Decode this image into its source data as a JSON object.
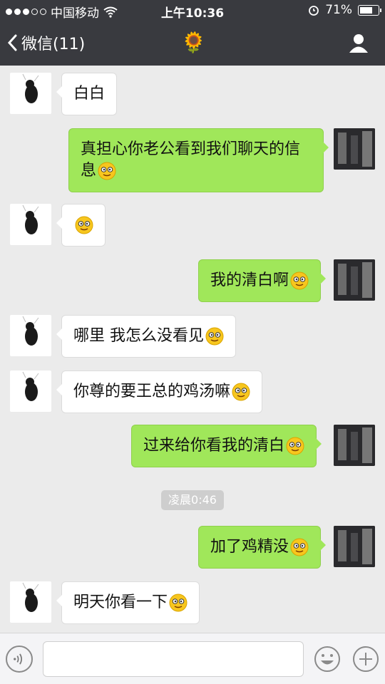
{
  "status": {
    "carrier": "中国移动",
    "time": "上午10:36",
    "battery": "71%",
    "battery_level": 0.71
  },
  "nav": {
    "back_label": "微信(11)",
    "center_icon": "sunflower-icon",
    "profile_icon": "person-icon"
  },
  "messages": [
    {
      "side": "left",
      "text": "白白"
    },
    {
      "side": "right",
      "text": "真担心你老公看到我们聊天的信息",
      "emoji": "grin-emoji"
    },
    {
      "side": "left",
      "text": "",
      "emoji": "grin-emoji"
    },
    {
      "side": "right",
      "text": "我的清白啊",
      "emoji": "grin-emoji"
    },
    {
      "side": "left",
      "text": "哪里 我怎么没看见",
      "emoji": "grin-emoji"
    },
    {
      "side": "left",
      "text": "你尊的要王总的鸡汤嘛",
      "emoji": "grin-emoji"
    },
    {
      "side": "right",
      "text": "过来给你看我的清白",
      "emoji": "grin-emoji"
    },
    {
      "side": "right",
      "text": "加了鸡精没",
      "emoji": "grin-emoji"
    },
    {
      "side": "left",
      "text": "明天你看一下",
      "emoji": "grin-emoji"
    }
  ],
  "timestamp": "凌晨0:46",
  "input": {
    "voice_icon": "voice-icon",
    "emoji_icon": "smile-icon",
    "plus_icon": "plus-icon",
    "placeholder": ""
  },
  "colors": {
    "header_bg": "#393a3f",
    "chat_bg": "#ebebeb",
    "bubble_self": "#a0e75a",
    "bubble_other": "#ffffff"
  }
}
